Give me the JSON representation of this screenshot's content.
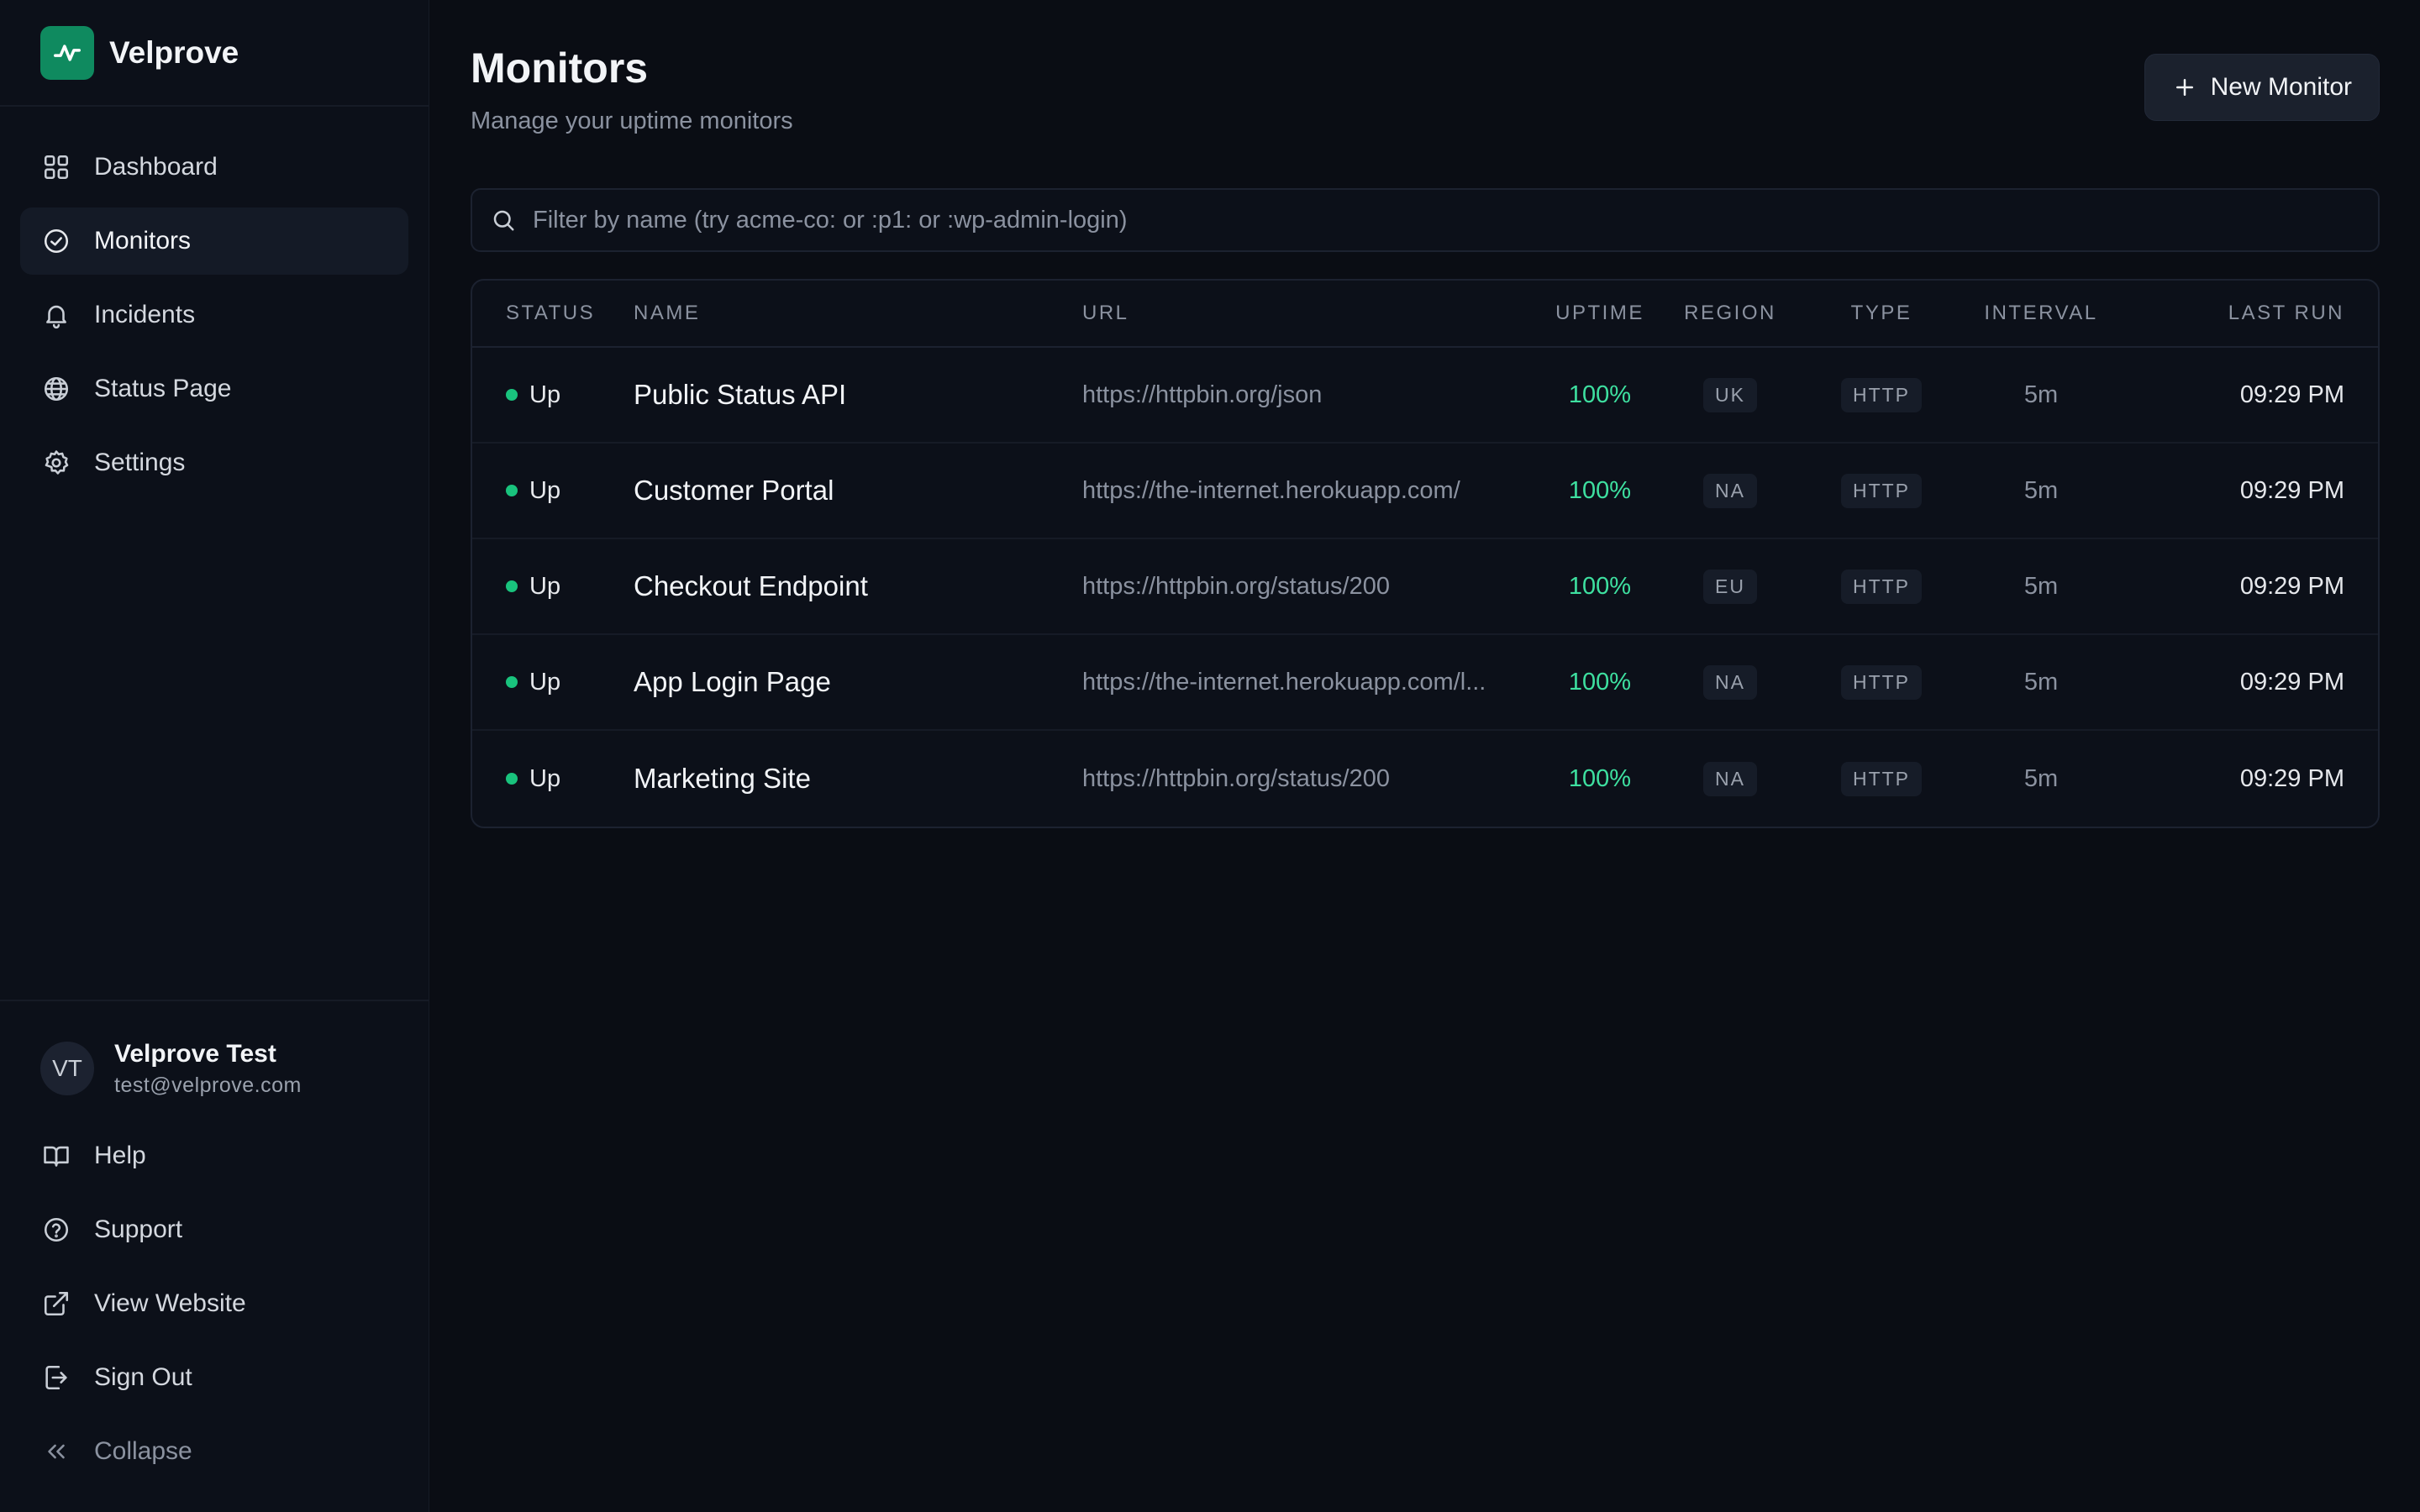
{
  "brand": {
    "name": "Velprove",
    "accent": "#0f8a5f"
  },
  "nav": [
    {
      "label": "Dashboard",
      "icon": "grid-icon",
      "active": false
    },
    {
      "label": "Monitors",
      "icon": "check-circle-icon",
      "active": true
    },
    {
      "label": "Incidents",
      "icon": "bell-icon",
      "active": false
    },
    {
      "label": "Status Page",
      "icon": "globe-icon",
      "active": false
    },
    {
      "label": "Settings",
      "icon": "gear-icon",
      "active": false
    }
  ],
  "user": {
    "initials": "VT",
    "name": "Velprove Test",
    "email": "test@velprove.com"
  },
  "footer_nav": [
    {
      "label": "Help",
      "icon": "book-icon"
    },
    {
      "label": "Support",
      "icon": "help-circle-icon"
    },
    {
      "label": "View Website",
      "icon": "external-link-icon"
    },
    {
      "label": "Sign Out",
      "icon": "sign-out-icon"
    },
    {
      "label": "Collapse",
      "icon": "chevrons-left-icon"
    }
  ],
  "page": {
    "title": "Monitors",
    "subtitle": "Manage your uptime monitors",
    "new_button": "New Monitor"
  },
  "search": {
    "placeholder": "Filter by name (try acme-co: or :p1: or :wp-admin-login)"
  },
  "table": {
    "columns": [
      "Status",
      "Name",
      "URL",
      "Uptime",
      "Region",
      "Type",
      "Interval",
      "Last Run"
    ],
    "rows": [
      {
        "status": "Up",
        "name": "Public Status API",
        "url": "https://httpbin.org/json",
        "uptime": "100%",
        "region": "UK",
        "type": "HTTP",
        "interval": "5m",
        "last_run": "09:29 PM"
      },
      {
        "status": "Up",
        "name": "Customer Portal",
        "url": "https://the-internet.herokuapp.com/",
        "uptime": "100%",
        "region": "NA",
        "type": "HTTP",
        "interval": "5m",
        "last_run": "09:29 PM"
      },
      {
        "status": "Up",
        "name": "Checkout Endpoint",
        "url": "https://httpbin.org/status/200",
        "uptime": "100%",
        "region": "EU",
        "type": "HTTP",
        "interval": "5m",
        "last_run": "09:29 PM"
      },
      {
        "status": "Up",
        "name": "App Login Page",
        "url": "https://the-internet.herokuapp.com/l...",
        "uptime": "100%",
        "region": "NA",
        "type": "HTTP",
        "interval": "5m",
        "last_run": "09:29 PM"
      },
      {
        "status": "Up",
        "name": "Marketing Site",
        "url": "https://httpbin.org/status/200",
        "uptime": "100%",
        "region": "NA",
        "type": "HTTP",
        "interval": "5m",
        "last_run": "09:29 PM"
      }
    ]
  },
  "colors": {
    "status_up": "#19c37d",
    "uptime_text": "#3ee0a0",
    "background": "#0a0d14"
  }
}
